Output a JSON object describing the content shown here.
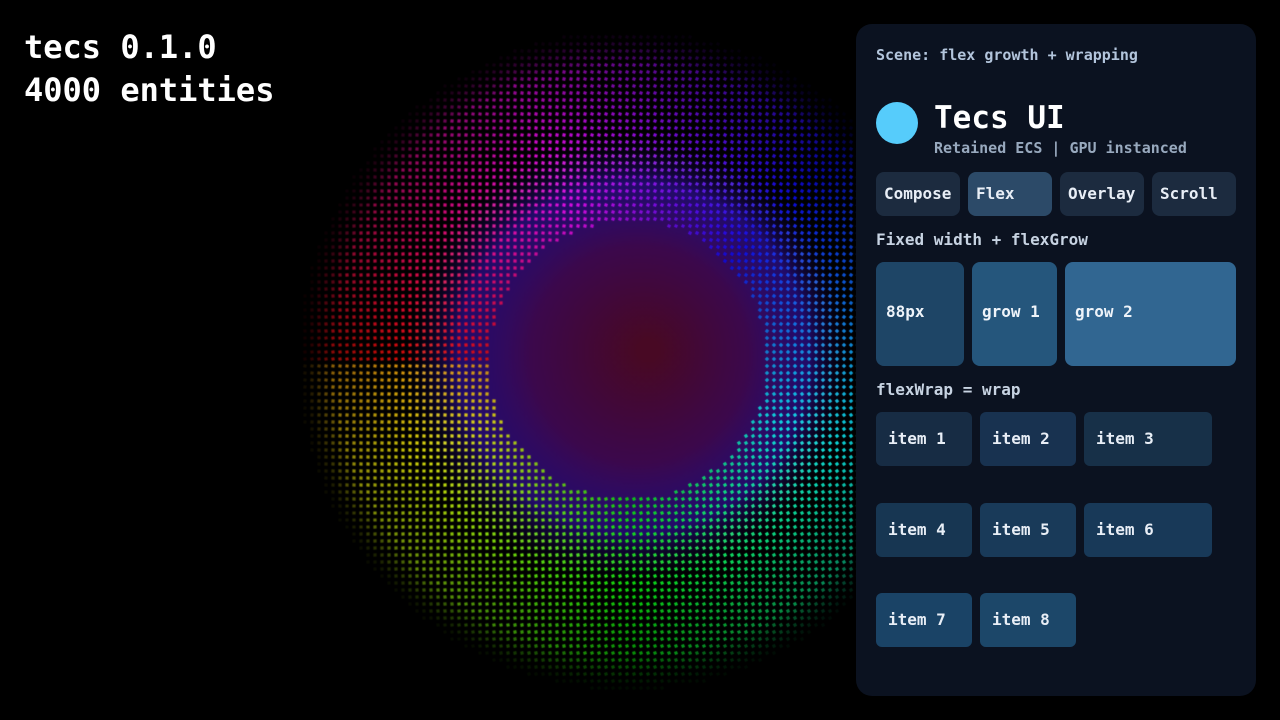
{
  "hud": {
    "version": "tecs 0.1.0",
    "entities": "4000 entities"
  },
  "panel": {
    "scene": "Scene: flex growth + wrapping",
    "title": "Tecs UI",
    "subtitle": "Retained ECS | GPU instanced",
    "tabs": [
      {
        "label": "Compose"
      },
      {
        "label": "Flex"
      },
      {
        "label": "Overlay"
      },
      {
        "label": "Scroll"
      }
    ],
    "active_tab": "Flex",
    "flex_grow": {
      "label": "Fixed width + flexGrow",
      "boxes": [
        {
          "label": "88px"
        },
        {
          "label": "grow 1"
        },
        {
          "label": "grow 2"
        }
      ]
    },
    "flex_wrap": {
      "label": "flexWrap = wrap",
      "items": [
        {
          "label": "item 1"
        },
        {
          "label": "item 2"
        },
        {
          "label": "item 3"
        },
        {
          "label": "item 4"
        },
        {
          "label": "item 5"
        },
        {
          "label": "item 6"
        },
        {
          "label": "item 7"
        },
        {
          "label": "item 8"
        }
      ]
    }
  },
  "colors": {
    "background": "#000000",
    "panel": "#0b1220",
    "avatar": "#56ccfb",
    "tab": "#1c2b3f",
    "tab_active": "#2c4a68",
    "box_fixed": "#1e4566",
    "box_grow1": "#25567c",
    "box_grow2": "#316691"
  }
}
